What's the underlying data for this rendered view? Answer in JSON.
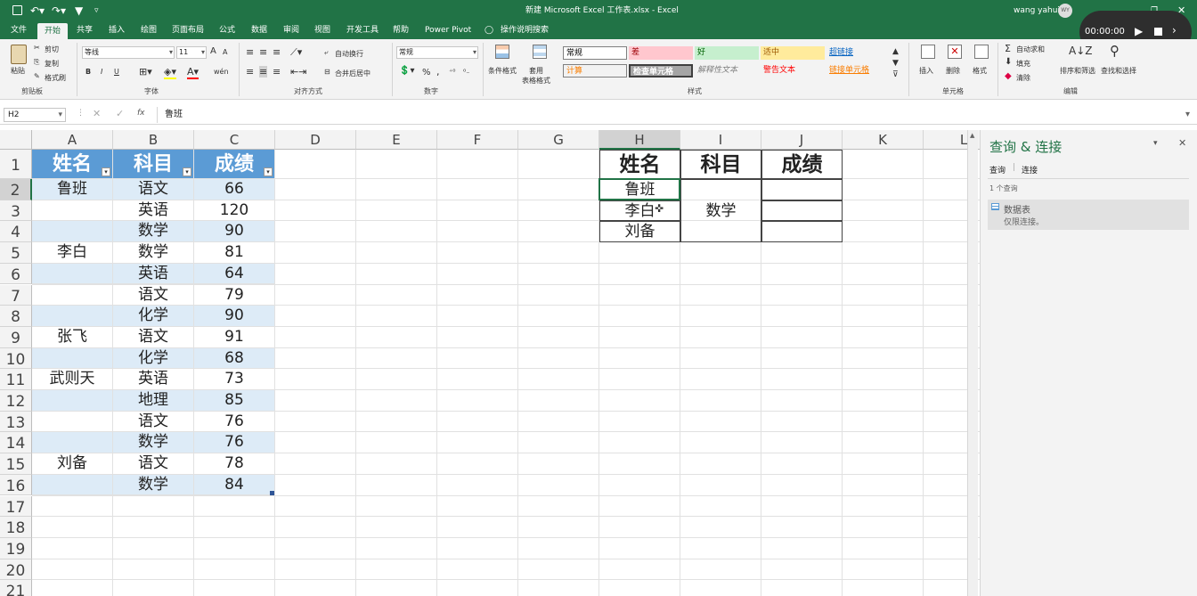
{
  "titlebar": {
    "title": "新建 Microsoft Excel 工作表.xlsx  -  Excel",
    "user": "wang yahui",
    "avatar_initials": "WY"
  },
  "recorder": {
    "time": "00:00:00"
  },
  "tabs": [
    "文件",
    "共享",
    "开始",
    "插入",
    "绘图",
    "页面布局",
    "公式",
    "数据",
    "审阅",
    "视图",
    "开发工具",
    "帮助",
    "Power Pivot",
    "操作说明搜索"
  ],
  "ribbon": {
    "clipboard": {
      "paste": "粘贴",
      "cut": "剪切",
      "copy": "复制",
      "format_painter": "格式刷",
      "label": "剪贴板"
    },
    "font": {
      "name": "等线",
      "size": "11",
      "bold": "B",
      "italic": "I",
      "underline": "U",
      "label": "字体",
      "wen": "wén",
      "grow": "A",
      "shrink": "A"
    },
    "align": {
      "wrap": "自动换行",
      "merge": "合并后居中",
      "label": "对齐方式"
    },
    "number": {
      "format": "常规",
      "pct": "%",
      "comma": ",",
      "label": "数字"
    },
    "styles": {
      "cond": "条件格式",
      "table": "套用\n表格格式",
      "label": "样式",
      "boxes": [
        {
          "text": "常规",
          "bg": "#ffffff",
          "fg": "#000000"
        },
        {
          "text": "差",
          "bg": "#ffc7ce",
          "fg": "#9c0006"
        },
        {
          "text": "好",
          "bg": "#c6efce",
          "fg": "#006100"
        },
        {
          "text": "适中",
          "bg": "#ffeb9c",
          "fg": "#9c5700"
        },
        {
          "text": "超链接",
          "bg": "#f3f3f3",
          "fg": "#0563c1"
        },
        {
          "text": "计算",
          "bg": "#f2f2f2",
          "fg": "#fa7d00"
        },
        {
          "text": "检查单元格",
          "bg": "#a5a5a5",
          "fg": "#ffffff"
        },
        {
          "text": "解释性文本",
          "bg": "#f3f3f3",
          "fg": "#7f7f7f"
        },
        {
          "text": "警告文本",
          "bg": "#f3f3f3",
          "fg": "#ff0000"
        },
        {
          "text": "链接单元格",
          "bg": "#f3f3f3",
          "fg": "#fa7d00"
        }
      ]
    },
    "cells": {
      "insert": "插入",
      "delete": "删除",
      "format": "格式",
      "label": "单元格"
    },
    "edit": {
      "autosum": "自动求和",
      "fill": "填充",
      "clear": "清除",
      "sort": "排序和筛选",
      "find": "查找和选择",
      "label": "编辑"
    }
  },
  "formula_bar": {
    "namebox": "H2",
    "value": "鲁班",
    "fx": "fx"
  },
  "columns": [
    "A",
    "B",
    "C",
    "D",
    "E",
    "F",
    "G",
    "H",
    "I",
    "J",
    "K",
    "L"
  ],
  "rows": [
    "1",
    "2",
    "3",
    "4",
    "5",
    "6",
    "7",
    "8",
    "9",
    "10",
    "11",
    "12",
    "13",
    "14",
    "15",
    "16",
    "17",
    "18",
    "19",
    "20",
    "21"
  ],
  "table": {
    "headers": [
      "姓名",
      "科目",
      "成绩"
    ],
    "rows": [
      [
        "鲁班",
        "语文",
        "66"
      ],
      [
        "",
        "英语",
        "120"
      ],
      [
        "",
        "数学",
        "90"
      ],
      [
        "李白",
        "数学",
        "81"
      ],
      [
        "",
        "英语",
        "64"
      ],
      [
        "",
        "语文",
        "79"
      ],
      [
        "",
        "化学",
        "90"
      ],
      [
        "张飞",
        "语文",
        "91"
      ],
      [
        "",
        "化学",
        "68"
      ],
      [
        "武则天",
        "英语",
        "73"
      ],
      [
        "",
        "地理",
        "85"
      ],
      [
        "",
        "语文",
        "76"
      ],
      [
        "",
        "数学",
        "76"
      ],
      [
        "刘备",
        "语文",
        "78"
      ],
      [
        "",
        "数学",
        "84"
      ]
    ]
  },
  "query_table": {
    "headers": [
      "姓名",
      "科目",
      "成绩"
    ],
    "names": [
      "鲁班",
      "李白",
      "刘备"
    ],
    "subject": "数学"
  },
  "pane": {
    "title": "查询 & 连接",
    "tab_query": "查询",
    "tab_conn": "连接",
    "count": "1 个查询",
    "item_name": "数据表",
    "item_status": "仅限连接。"
  }
}
